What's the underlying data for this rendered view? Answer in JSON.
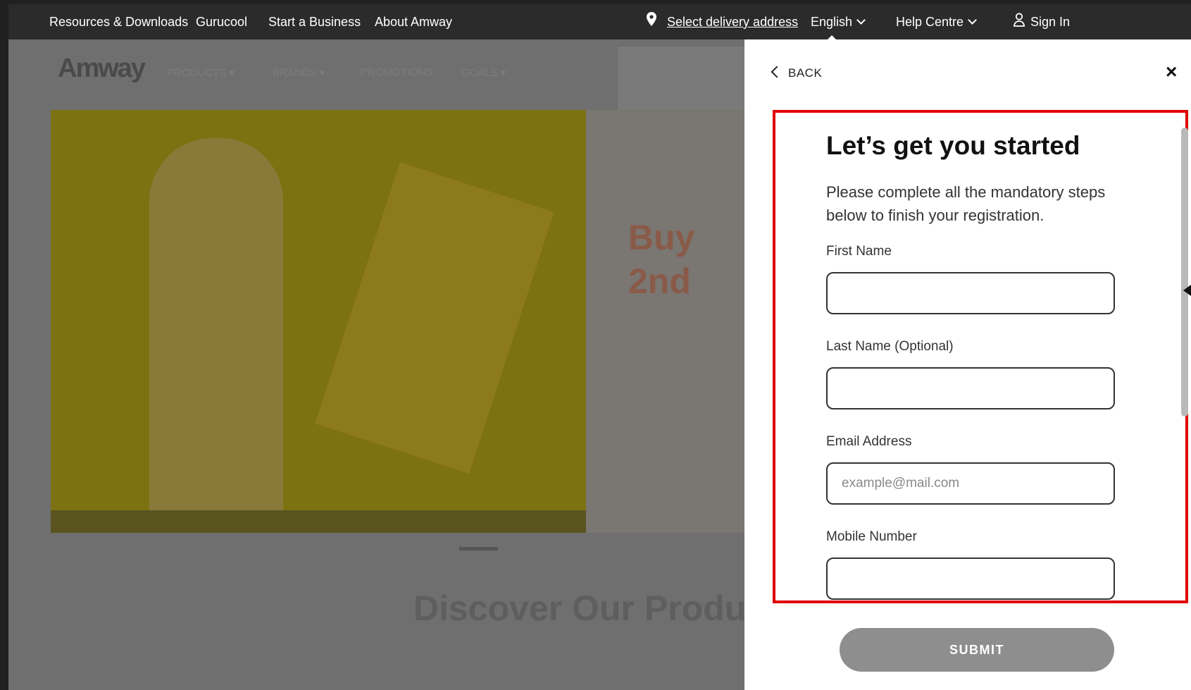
{
  "topbar": {
    "links": [
      "Resources & Downloads",
      "Gurucool",
      "Start a Business",
      "About Amway"
    ],
    "delivery": "Select delivery address",
    "language": "English",
    "help": "Help Centre",
    "signin": "Sign In"
  },
  "background": {
    "logo": "Amway",
    "discover": "Discover Our Produc",
    "promo_big": "Buy\n2nd"
  },
  "panel": {
    "back": "BACK",
    "close": "×",
    "title": "Let’s get you started",
    "subtitle": "Please complete all the mandatory steps below to finish your registration.",
    "fields": {
      "first_name_label": "First Name",
      "first_name_value": "",
      "last_name_label": "Last Name (Optional)",
      "last_name_value": "",
      "email_label": "Email Address",
      "email_placeholder": "example@mail.com",
      "mobile_label": "Mobile Number"
    },
    "submit": "SUBMIT"
  },
  "colors": {
    "topbar": "#2b2b2b",
    "highlight": "#e00000",
    "submit": "#8e8e8e"
  }
}
